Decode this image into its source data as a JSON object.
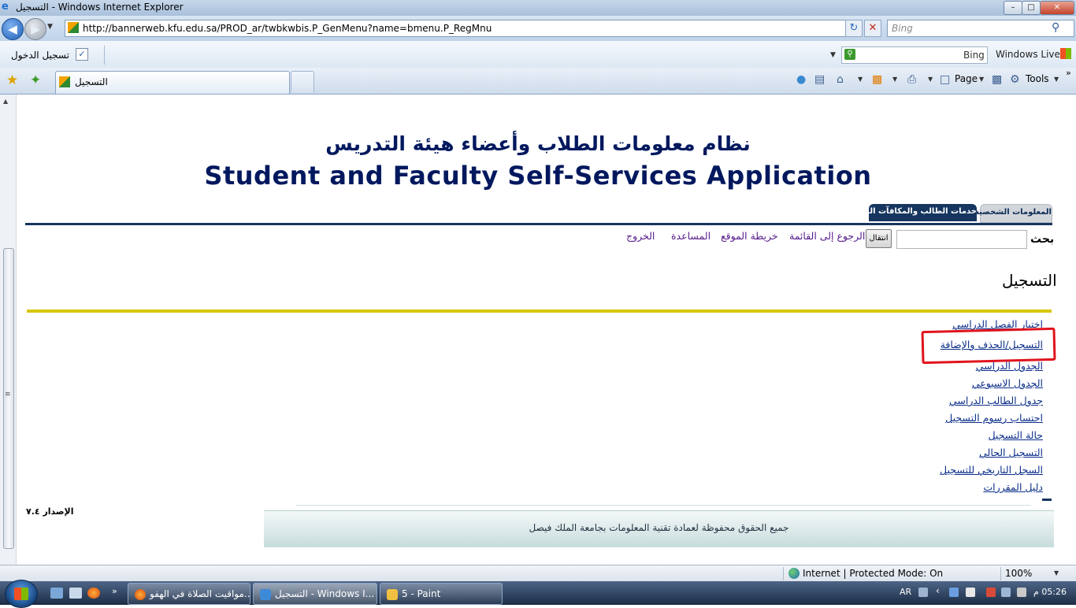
{
  "window": {
    "title": "التسجيل - Windows Internet Explorer"
  },
  "address_bar": {
    "url": "http://bannerweb.kfu.edu.sa/PROD_ar/twbkwbis.P_GenMenu?name=bmenu.P_RegMnu",
    "search_placeholder": "Bing"
  },
  "toolbar": {
    "login_label": "تسجيل الدخول",
    "bing_text": "Bing",
    "windows_live": "Windows Live"
  },
  "tabs": {
    "active_label": "التسجيل",
    "page_label": "Page",
    "tools_label": "Tools"
  },
  "page": {
    "title_ar": "نظام معلومات الطلاب وأعضاء هيئة التدريس",
    "title_en": "Student and Faculty Self-Services Application",
    "tab_personal": "المعلومات الشخصية",
    "tab_services": "خدمات الطالب والمكافآت المالية",
    "search_label": "بحث",
    "go_button": "انتقال",
    "top_links": [
      "الرجوع إلى القائمة",
      "خريطة الموقع",
      "المساعدة",
      "الخروج"
    ],
    "heading": "التسجيل",
    "menu_items": [
      "اختيار الفصل الدراسي",
      "التسجيل/الحذف والإضافة",
      "الجدول الدراسي",
      "الجدول الاسبوعي",
      "جدول الطالب الدراسي",
      "احتساب رسوم التسجيل",
      "حالة التسجيل",
      "التسجيل الحالي",
      "السجل التاريخي للتسجيل",
      "دليل المقررات"
    ],
    "version": "الإصدار ٧.٤",
    "footer": "جميع الحقوق محفوظة لعمادة تقنية المعلومات بجامعة الملك فيصل"
  },
  "status_bar": {
    "zone": "Internet | Protected Mode: On",
    "zoom": "100%"
  },
  "taskbar": {
    "items": [
      "مواقيت الصلاة في الهفو...",
      "التسجيل - Windows I...",
      "5 - Paint"
    ],
    "language": "AR",
    "clock": "05:26 م"
  },
  "colors": {
    "heading_navy": "#00185e",
    "highlight_red": "#e0141c",
    "divider_yellow": "#d8c608",
    "nav_navy": "#16365f"
  }
}
